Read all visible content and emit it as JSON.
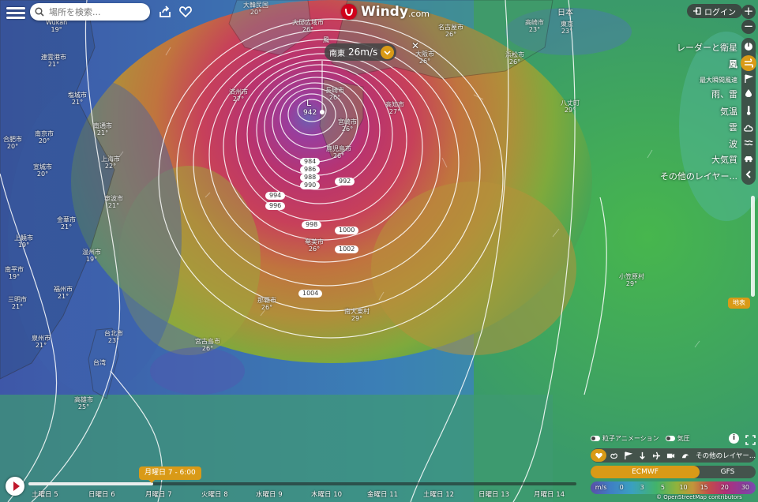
{
  "header": {
    "search_placeholder": "場所を検索...",
    "logo_name": "Windy",
    "logo_suffix": ".com",
    "login_label": "ログイン"
  },
  "icons": [
    "menu-icon",
    "search-icon",
    "share-icon",
    "heart-icon",
    "login-icon",
    "plus-icon",
    "minus-icon",
    "radar-icon",
    "wind-icon",
    "flag-icon",
    "drop-icon",
    "thermometer-icon",
    "cloud-icon",
    "wave-icon",
    "car-icon",
    "chevron-left-icon",
    "play-icon",
    "chevron-down-icon",
    "close-icon"
  ],
  "colors": {
    "accent": "#d99a17",
    "brand_red": "#d0021b"
  },
  "layers": [
    {
      "label": "レーダーと衛星",
      "icon": "radar-icon",
      "active": false,
      "small": false
    },
    {
      "label": "風",
      "icon": "wind-icon",
      "active": true,
      "small": false
    },
    {
      "label": "最大瞬間風速",
      "icon": "flag-icon",
      "active": false,
      "small": true
    },
    {
      "label": "雨、雷",
      "icon": "drop-icon",
      "active": false,
      "small": false
    },
    {
      "label": "気温",
      "icon": "thermometer-icon",
      "active": false,
      "small": false
    },
    {
      "label": "雲",
      "icon": "cloud-icon",
      "active": false,
      "small": false
    },
    {
      "label": "波",
      "icon": "wave-icon",
      "active": false,
      "small": false
    },
    {
      "label": "大気質",
      "icon": "car-icon",
      "active": false,
      "small": false
    },
    {
      "label": "その他のレイヤー...",
      "icon": "chevron-left-icon",
      "active": false,
      "small": false
    }
  ],
  "elevation_tag": "地表",
  "popup": {
    "tag": "風",
    "direction": "南東",
    "speed": "26m/s"
  },
  "storm": {
    "center_label": "L",
    "center_pressure": "942"
  },
  "isobars": [
    "984",
    "986",
    "988",
    "990",
    "992",
    "994",
    "996",
    "998",
    "1000",
    "1002",
    "1004"
  ],
  "cities": [
    {
      "name": "大韓民国",
      "temp": "20°"
    },
    {
      "name": "済州市",
      "temp": "27°"
    },
    {
      "name": "大邱広域市",
      "temp": "26°"
    },
    {
      "name": "長崎市",
      "temp": "26°"
    },
    {
      "name": "鹿児島市",
      "temp": "26°"
    },
    {
      "name": "宮崎市",
      "temp": "26°"
    },
    {
      "name": "高知市",
      "temp": "27°"
    },
    {
      "name": "大阪市",
      "temp": "26°"
    },
    {
      "name": "名古屋市",
      "temp": "26°"
    },
    {
      "name": "浜松市",
      "temp": "26°"
    },
    {
      "name": "八丈町",
      "temp": "29°"
    },
    {
      "name": "Wukan",
      "temp": "19°"
    },
    {
      "name": "連雲港市",
      "temp": "21°"
    },
    {
      "name": "塩城市",
      "temp": "21°"
    },
    {
      "name": "南通市",
      "temp": "21°"
    },
    {
      "name": "南京市",
      "temp": "20°"
    },
    {
      "name": "合肥市",
      "temp": "20°"
    },
    {
      "name": "宣城市",
      "temp": "20°"
    },
    {
      "name": "上海市",
      "temp": "22°"
    },
    {
      "name": "寧波市",
      "temp": "21°"
    },
    {
      "name": "金華市",
      "temp": "21°"
    },
    {
      "name": "温州市",
      "temp": "19°"
    },
    {
      "name": "上饒市",
      "temp": "19°"
    },
    {
      "name": "南平市",
      "temp": "19°"
    },
    {
      "name": "三明市",
      "temp": "21°"
    },
    {
      "name": "福州市",
      "temp": "21°"
    },
    {
      "name": "泉州市",
      "temp": "21°"
    },
    {
      "name": "台北市",
      "temp": "23°"
    },
    {
      "name": "台湾",
      "temp": ""
    },
    {
      "name": "高雄市",
      "temp": "25°"
    },
    {
      "name": "宮古島市",
      "temp": "26°"
    },
    {
      "name": "那覇市",
      "temp": "26°"
    },
    {
      "name": "奄美市",
      "temp": "26°"
    },
    {
      "name": "南大東村",
      "temp": "29°"
    },
    {
      "name": "小笠原村",
      "temp": "29°"
    },
    {
      "name": "高崎市",
      "temp": "23°"
    },
    {
      "name": "東京",
      "temp": "23°"
    },
    {
      "name": "日本",
      "temp": ""
    }
  ],
  "toggles": [
    {
      "label": "粒子アニメーション"
    },
    {
      "label": "気圧"
    }
  ],
  "overlay_more": "その他のレイヤー...",
  "models": {
    "active": "ECMWF",
    "other": "GFS"
  },
  "scale": {
    "unit": "m/s",
    "values": [
      "0",
      "3",
      "5",
      "10",
      "15",
      "20",
      "30"
    ]
  },
  "attribution": "© OpenStreetMap contributors",
  "timeline": {
    "current": "月曜日 7 - 6:00",
    "days": [
      "土曜日 5",
      "日曜日 6",
      "月曜日 7",
      "火曜日 8",
      "水曜日 9",
      "木曜日 10",
      "金曜日 11",
      "土曜日 12",
      "日曜日 13",
      "月曜日 14"
    ]
  }
}
